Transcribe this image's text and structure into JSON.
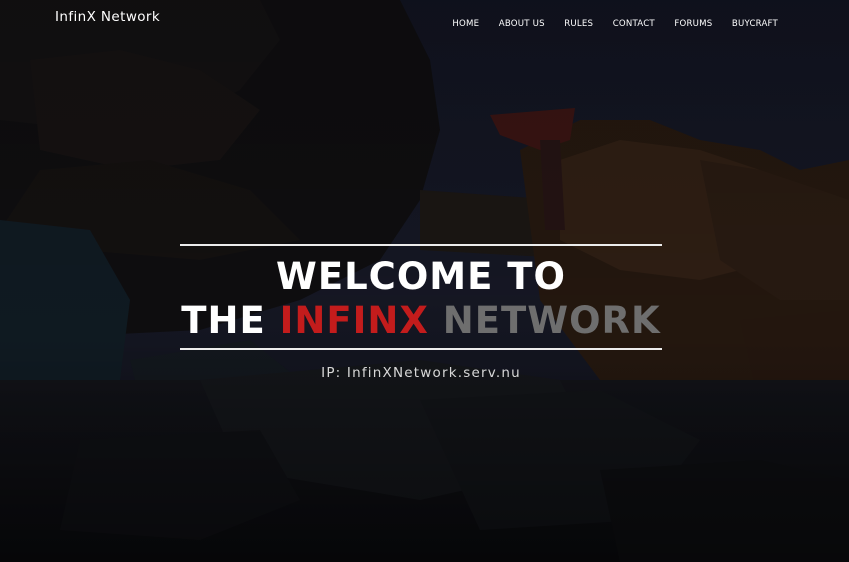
{
  "brand": {
    "name": "InfinX Network"
  },
  "nav": {
    "items": [
      {
        "label": "HOME"
      },
      {
        "label": "ABOUT US"
      },
      {
        "label": "RULES"
      },
      {
        "label": "CONTACT"
      },
      {
        "label": "FORUMS"
      },
      {
        "label": "BUYCRAFT"
      }
    ]
  },
  "hero": {
    "line1": "WELCOME TO",
    "line2_prefix": "THE ",
    "line2_red": "INFINX",
    "line2_gray": " NETWORK",
    "ip_text": "IP: InfinXNetwork.serv.nu"
  },
  "colors": {
    "accent_red": "#c31c1c",
    "accent_gray": "#6e6e6e",
    "rule": "#ececec",
    "background": "#0d0f16"
  }
}
